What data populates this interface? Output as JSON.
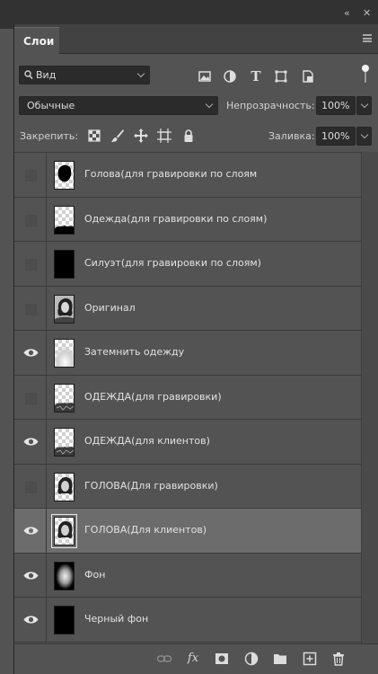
{
  "window": {
    "collapse_glyph": "«",
    "close_glyph": "✕"
  },
  "panel": {
    "tab_label": "Слои",
    "menu_icon": "panel-menu-icon"
  },
  "filter": {
    "search_icon": "search-icon",
    "kind_label": "Вид",
    "filter_icons": [
      "image-filter-icon",
      "adjustment-filter-icon",
      "type-filter-icon",
      "shape-filter-icon",
      "smartobject-filter-icon",
      "filter-toggle-icon"
    ]
  },
  "blend": {
    "mode": "Обычные",
    "opacity_label": "Непрозрачность:",
    "opacity_value": "100%"
  },
  "lock": {
    "label": "Закрепить:",
    "icons": [
      "lock-transparent-icon",
      "lock-image-icon",
      "lock-position-icon",
      "lock-artboard-icon",
      "lock-all-icon"
    ],
    "fill_label": "Заливка:",
    "fill_value": "100%"
  },
  "layers": [
    {
      "name": "Голова(для гравировки по слоям",
      "visible": false,
      "thumb": "head-silhouette"
    },
    {
      "name": "Одежда(для гравировки по слоям)",
      "visible": false,
      "thumb": "clothes-silhouette"
    },
    {
      "name": "Силуэт(для гравировки по слоям)",
      "visible": false,
      "thumb": "body-silhouette"
    },
    {
      "name": "Оригинал",
      "visible": false,
      "thumb": "portrait-photo"
    },
    {
      "name": "Затемнить одежду",
      "visible": true,
      "thumb": "gradient-mask"
    },
    {
      "name": "ОДЕЖДА(для гравировки)",
      "visible": false,
      "thumb": "clothes-photo"
    },
    {
      "name": "ОДЕЖДА(для клиентов)",
      "visible": true,
      "thumb": "clothes-photo"
    },
    {
      "name": "ГОЛОВА(Для гравировки)",
      "visible": false,
      "thumb": "head-photo"
    },
    {
      "name": "ГОЛОВА(Для клиентов)",
      "visible": true,
      "thumb": "head-photo",
      "selected": true
    },
    {
      "name": "Фон",
      "visible": true,
      "thumb": "glow-background"
    },
    {
      "name": "Черный фон",
      "visible": true,
      "thumb": "black-fill"
    }
  ],
  "footer": {
    "icons": [
      "link-layers-icon",
      "fx-icon",
      "add-mask-icon",
      "adjustment-layer-icon",
      "new-group-icon",
      "new-layer-icon",
      "delete-layer-icon"
    ],
    "fx_text": "fx"
  }
}
